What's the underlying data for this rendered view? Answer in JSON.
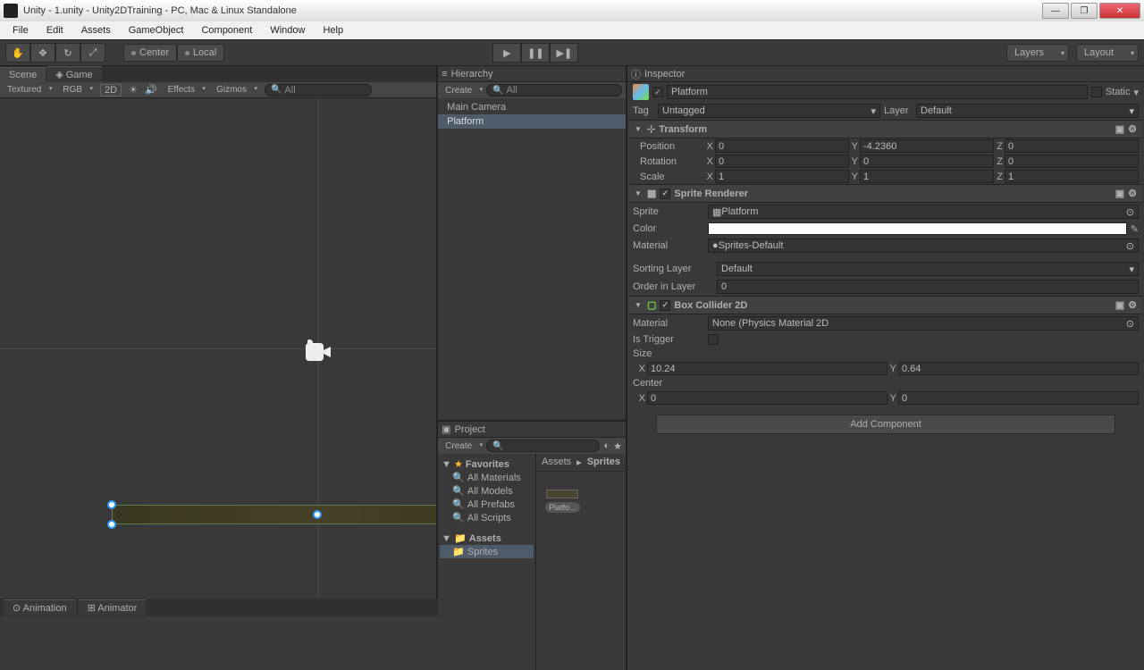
{
  "titlebar": "Unity - 1.unity - Unity2DTraining - PC, Mac & Linux Standalone",
  "menu": [
    "File",
    "Edit",
    "Assets",
    "GameObject",
    "Component",
    "Window",
    "Help"
  ],
  "toolbar": {
    "pivot": "Center",
    "handle": "Local",
    "layers": "Layers",
    "layout": "Layout"
  },
  "scene": {
    "tab_scene": "Scene",
    "tab_game": "Game",
    "shading": "Textured",
    "render": "RGB",
    "mode2d": "2D",
    "effects": "Effects",
    "gizmos": "Gizmos",
    "search_placeholder": "All"
  },
  "bottom_tabs": {
    "animation": "Animation",
    "animator": "Animator"
  },
  "hierarchy": {
    "title": "Hierarchy",
    "create": "Create",
    "search_placeholder": "All",
    "items": [
      "Main Camera",
      "Platform"
    ],
    "selected_index": 1
  },
  "project": {
    "title": "Project",
    "create": "Create",
    "favorites_label": "Favorites",
    "favorites": [
      "All Materials",
      "All Models",
      "All Prefabs",
      "All Scripts"
    ],
    "assets_label": "Assets",
    "assets_children": [
      "Sprites"
    ],
    "breadcrumb": [
      "Assets",
      "Sprites"
    ],
    "item_name": "Platfo..."
  },
  "inspector": {
    "title": "Inspector",
    "object_name": "Platform",
    "static_label": "Static",
    "tag_label": "Tag",
    "tag_value": "Untagged",
    "layer_label": "Layer",
    "layer_value": "Default",
    "transform": {
      "title": "Transform",
      "position": {
        "label": "Position",
        "x": "0",
        "y": "-4.2360",
        "z": "0"
      },
      "rotation": {
        "label": "Rotation",
        "x": "0",
        "y": "0",
        "z": "0"
      },
      "scale": {
        "label": "Scale",
        "x": "1",
        "y": "1",
        "z": "1"
      }
    },
    "sprite_renderer": {
      "title": "Sprite Renderer",
      "sprite_label": "Sprite",
      "sprite_value": "Platform",
      "color_label": "Color",
      "material_label": "Material",
      "material_value": "Sprites-Default",
      "sorting_label": "Sorting Layer",
      "sorting_value": "Default",
      "order_label": "Order in Layer",
      "order_value": "0"
    },
    "box_collider": {
      "title": "Box Collider 2D",
      "material_label": "Material",
      "material_value": "None (Physics Material 2D",
      "trigger_label": "Is Trigger",
      "size_label": "Size",
      "size_x": "10.24",
      "size_y": "0.64",
      "center_label": "Center",
      "center_x": "0",
      "center_y": "0"
    },
    "add_component": "Add Component"
  }
}
